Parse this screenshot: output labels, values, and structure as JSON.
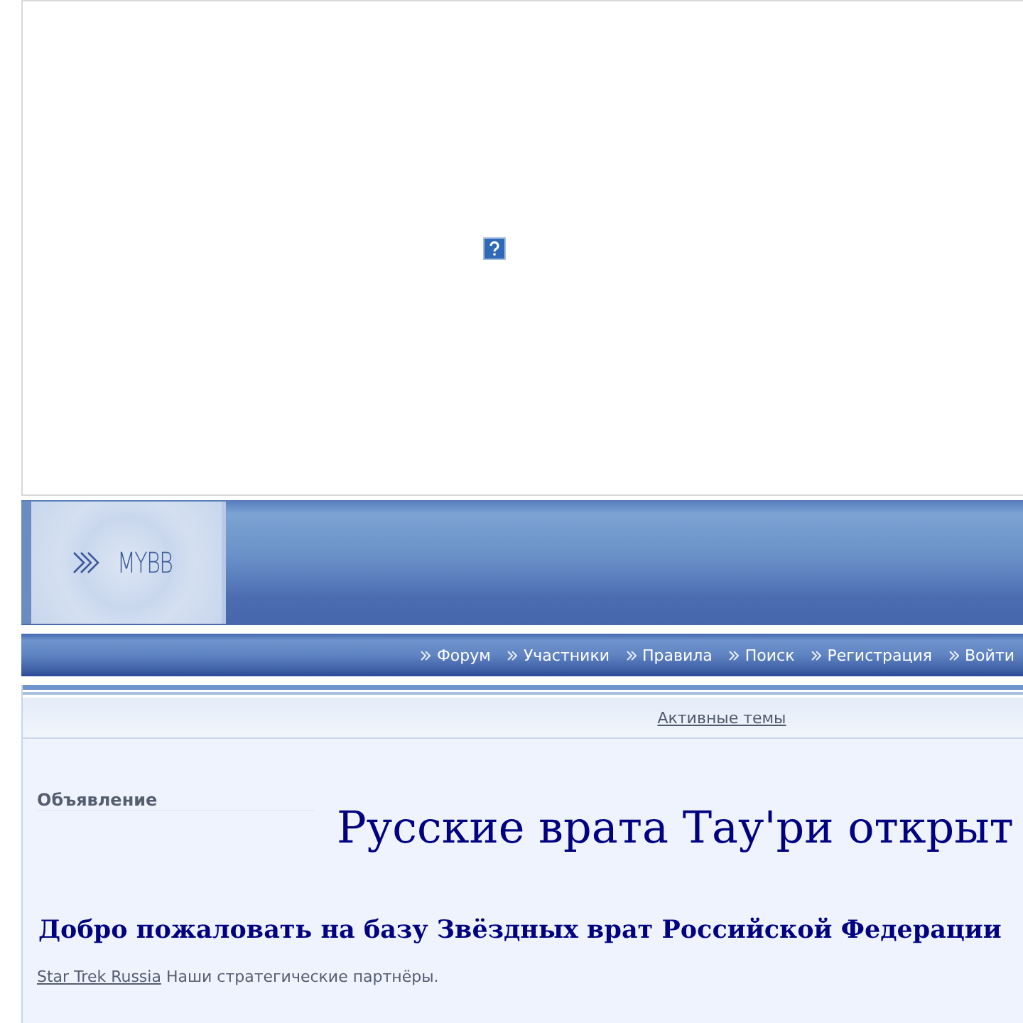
{
  "banner": {
    "broken_image": true
  },
  "header": {
    "logo_text": "MYBB"
  },
  "nav": {
    "items": [
      {
        "label": "Форум"
      },
      {
        "label": "Участники"
      },
      {
        "label": "Правила"
      },
      {
        "label": "Поиск"
      },
      {
        "label": "Регистрация"
      },
      {
        "label": "Войти"
      }
    ]
  },
  "subnav": {
    "link": "Активные темы"
  },
  "announcement": {
    "label": "Объявление",
    "title": "Русские врата Тау'ри открыт"
  },
  "welcome": {
    "heading": "Добро пожаловать на базу Звёздных врат Российской Федерации",
    "partner_link": "Star Trek Russia",
    "partner_text": "Наши стратегические партнёры."
  }
}
